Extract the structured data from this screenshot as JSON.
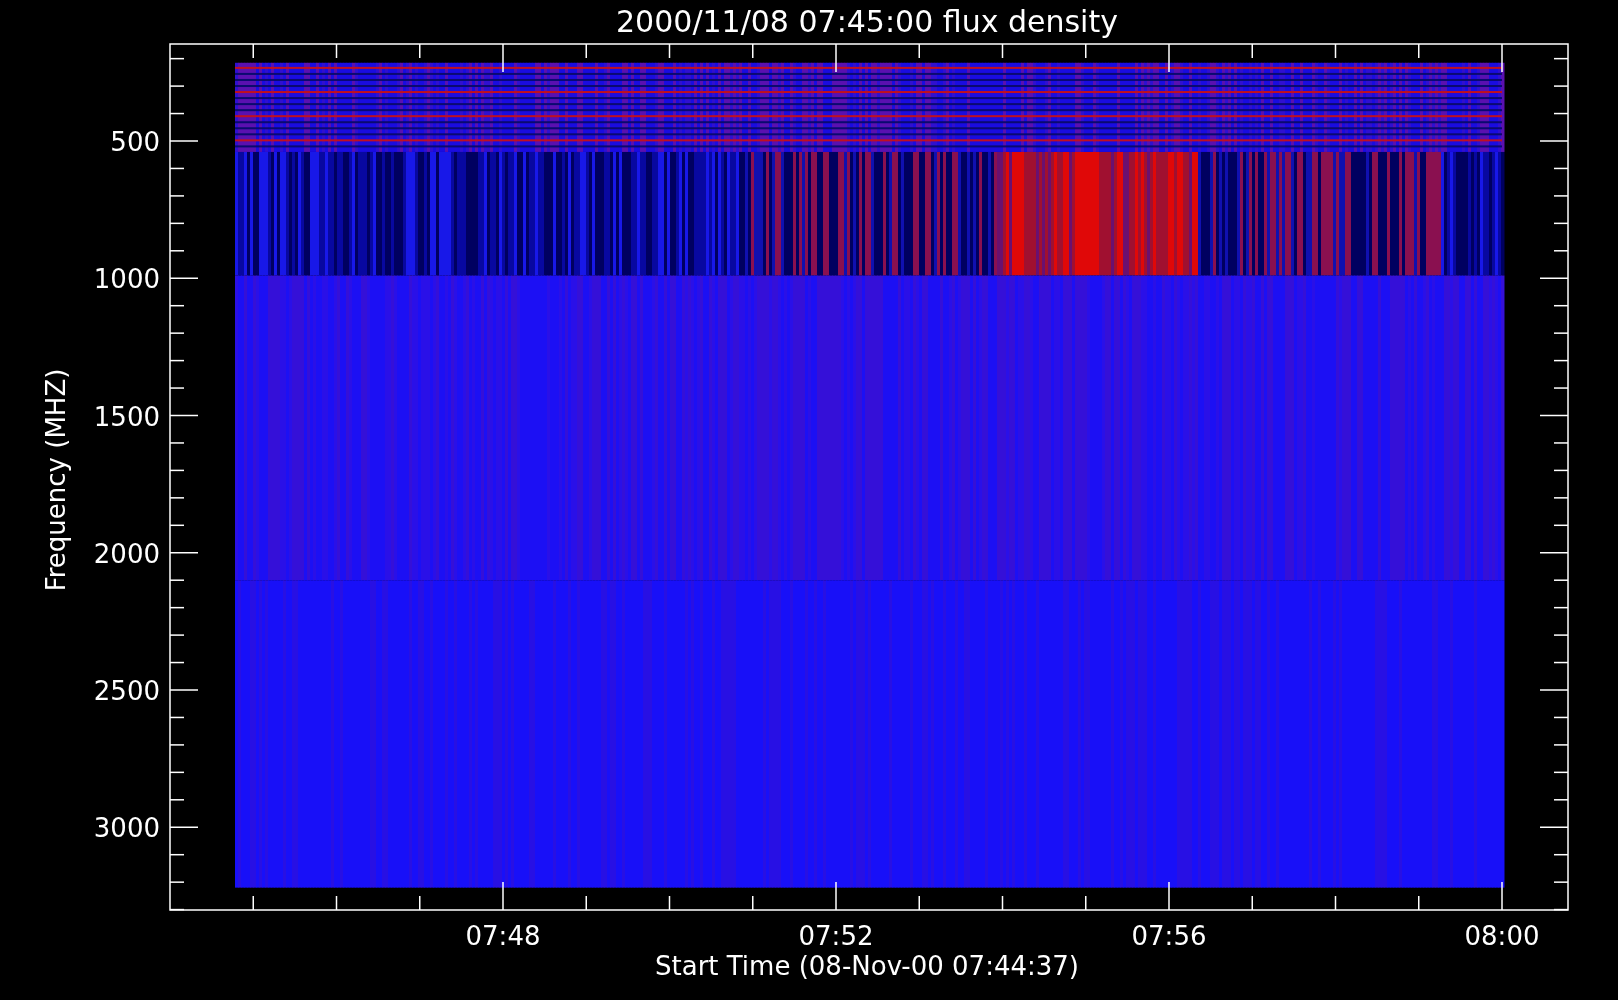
{
  "plot": {
    "title": "2000/11/08 07:45:00 flux density",
    "y_axis": {
      "label": "Frequency (MHZ)",
      "ticks": [
        "500",
        "1000",
        "1500",
        "2000",
        "2500",
        "3000"
      ]
    },
    "x_axis": {
      "label": "Start Time (08-Nov-00 07:44:37)",
      "ticks": [
        "07:48",
        "07:52",
        "07:56",
        "08:00"
      ]
    }
  }
}
